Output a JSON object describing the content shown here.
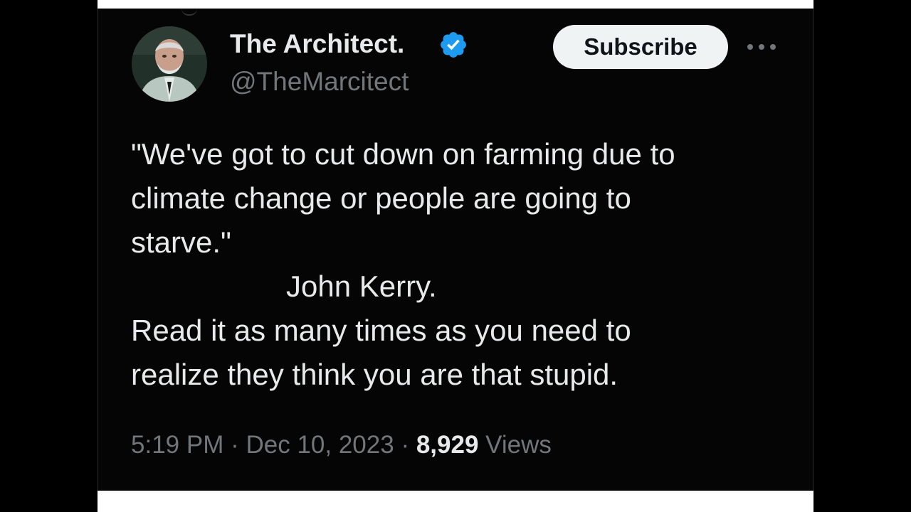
{
  "tweet": {
    "author": {
      "display_name": "The Architect.",
      "handle": "@TheMarcitect",
      "verified": true,
      "avatar_icon": "avatar-portrait"
    },
    "subscribe_label": "Subscribe",
    "more_icon": "more-horizontal-icon",
    "text_lines": [
      "\"We've got to cut down on farming due to",
      "climate change or people are going to",
      "starve.\"",
      "John Kerry.",
      "Read it as many times as you need to",
      "realize they think you are that stupid."
    ],
    "time": "5:19 PM",
    "date": "Dec 10, 2023",
    "separator": "·",
    "views_count": "8,929",
    "views_label": "Views"
  },
  "colors": {
    "background": "#000000",
    "text_primary": "#e7e9ea",
    "text_secondary": "#71767b",
    "verified_badge": "#1d9bf0",
    "button_bg": "#eff3f4"
  }
}
